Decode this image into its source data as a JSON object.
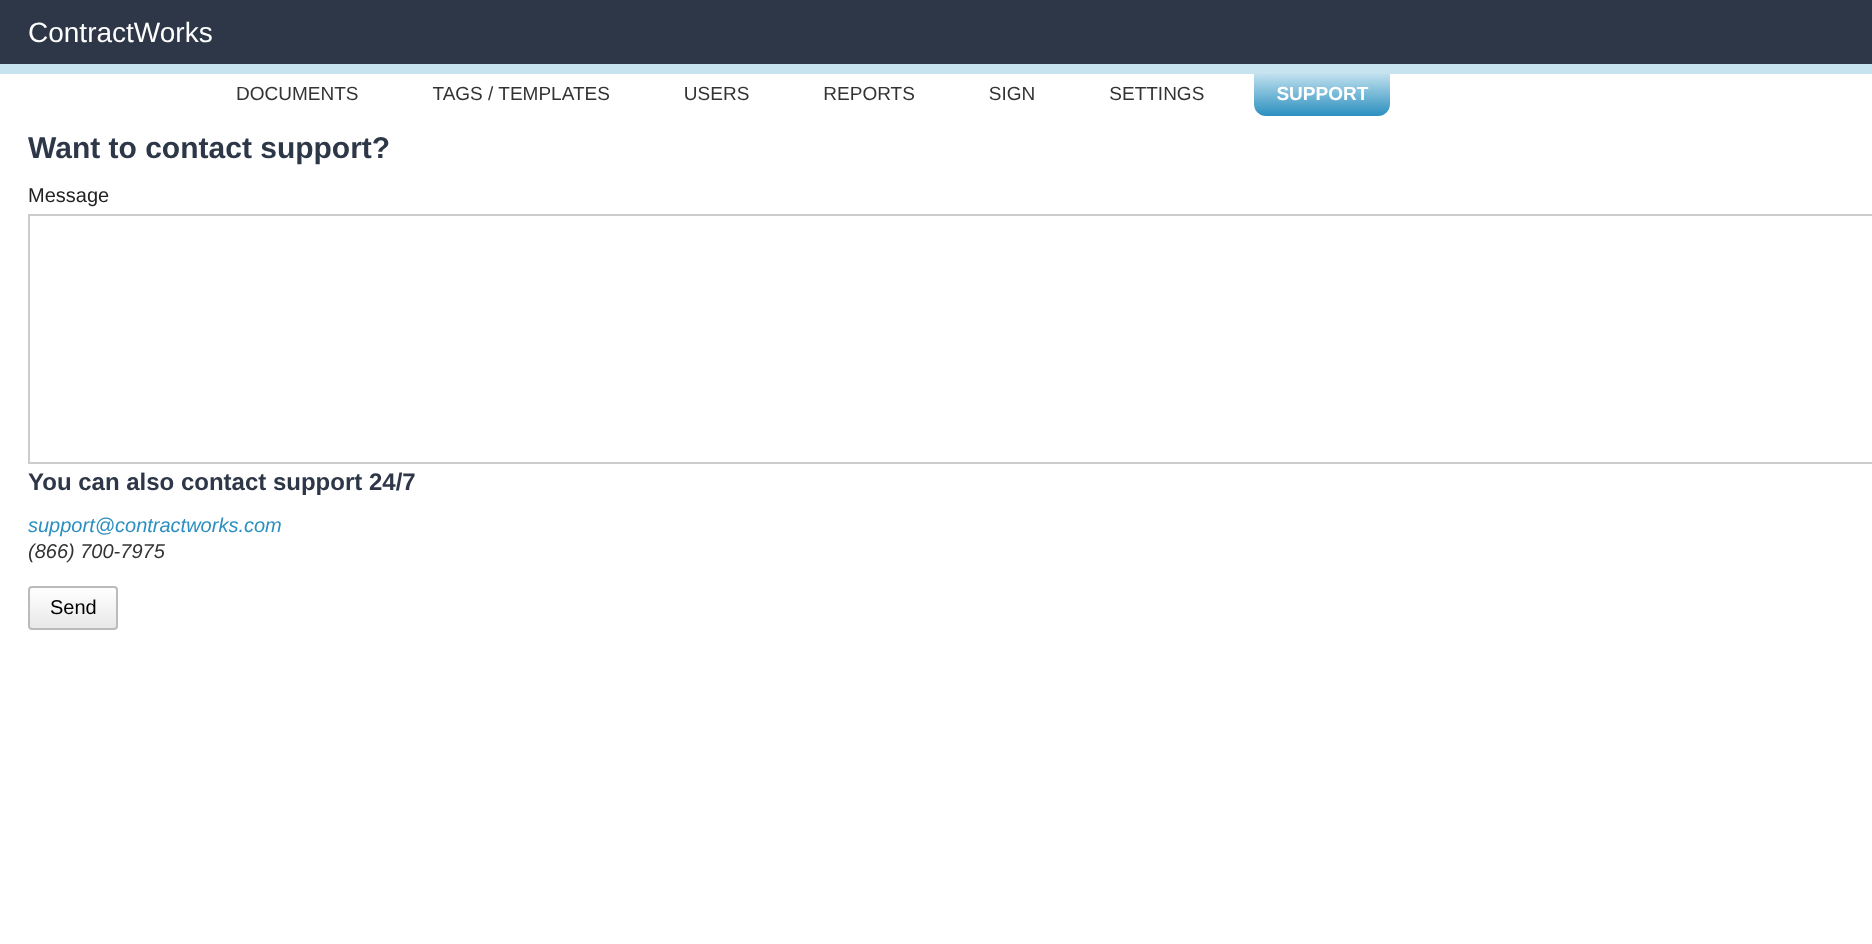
{
  "app": {
    "title": "ContractWorks"
  },
  "nav": [
    {
      "label": "DOCUMENTS",
      "selected": false
    },
    {
      "label": "TAGS / TEMPLATES",
      "selected": false
    },
    {
      "label": "USERS",
      "selected": false
    },
    {
      "label": "REPORTS",
      "selected": false
    },
    {
      "label": "SIGN",
      "selected": false
    },
    {
      "label": "SETTINGS",
      "selected": false
    },
    {
      "label": "SUPPORT",
      "selected": true
    }
  ],
  "form": {
    "heading": "Want to contact support?",
    "message_label": "Message",
    "subheading": "You can also contact support 24/7",
    "email": "support@contractworks.com",
    "phone": "(866) 700-7975",
    "send": "Send"
  }
}
